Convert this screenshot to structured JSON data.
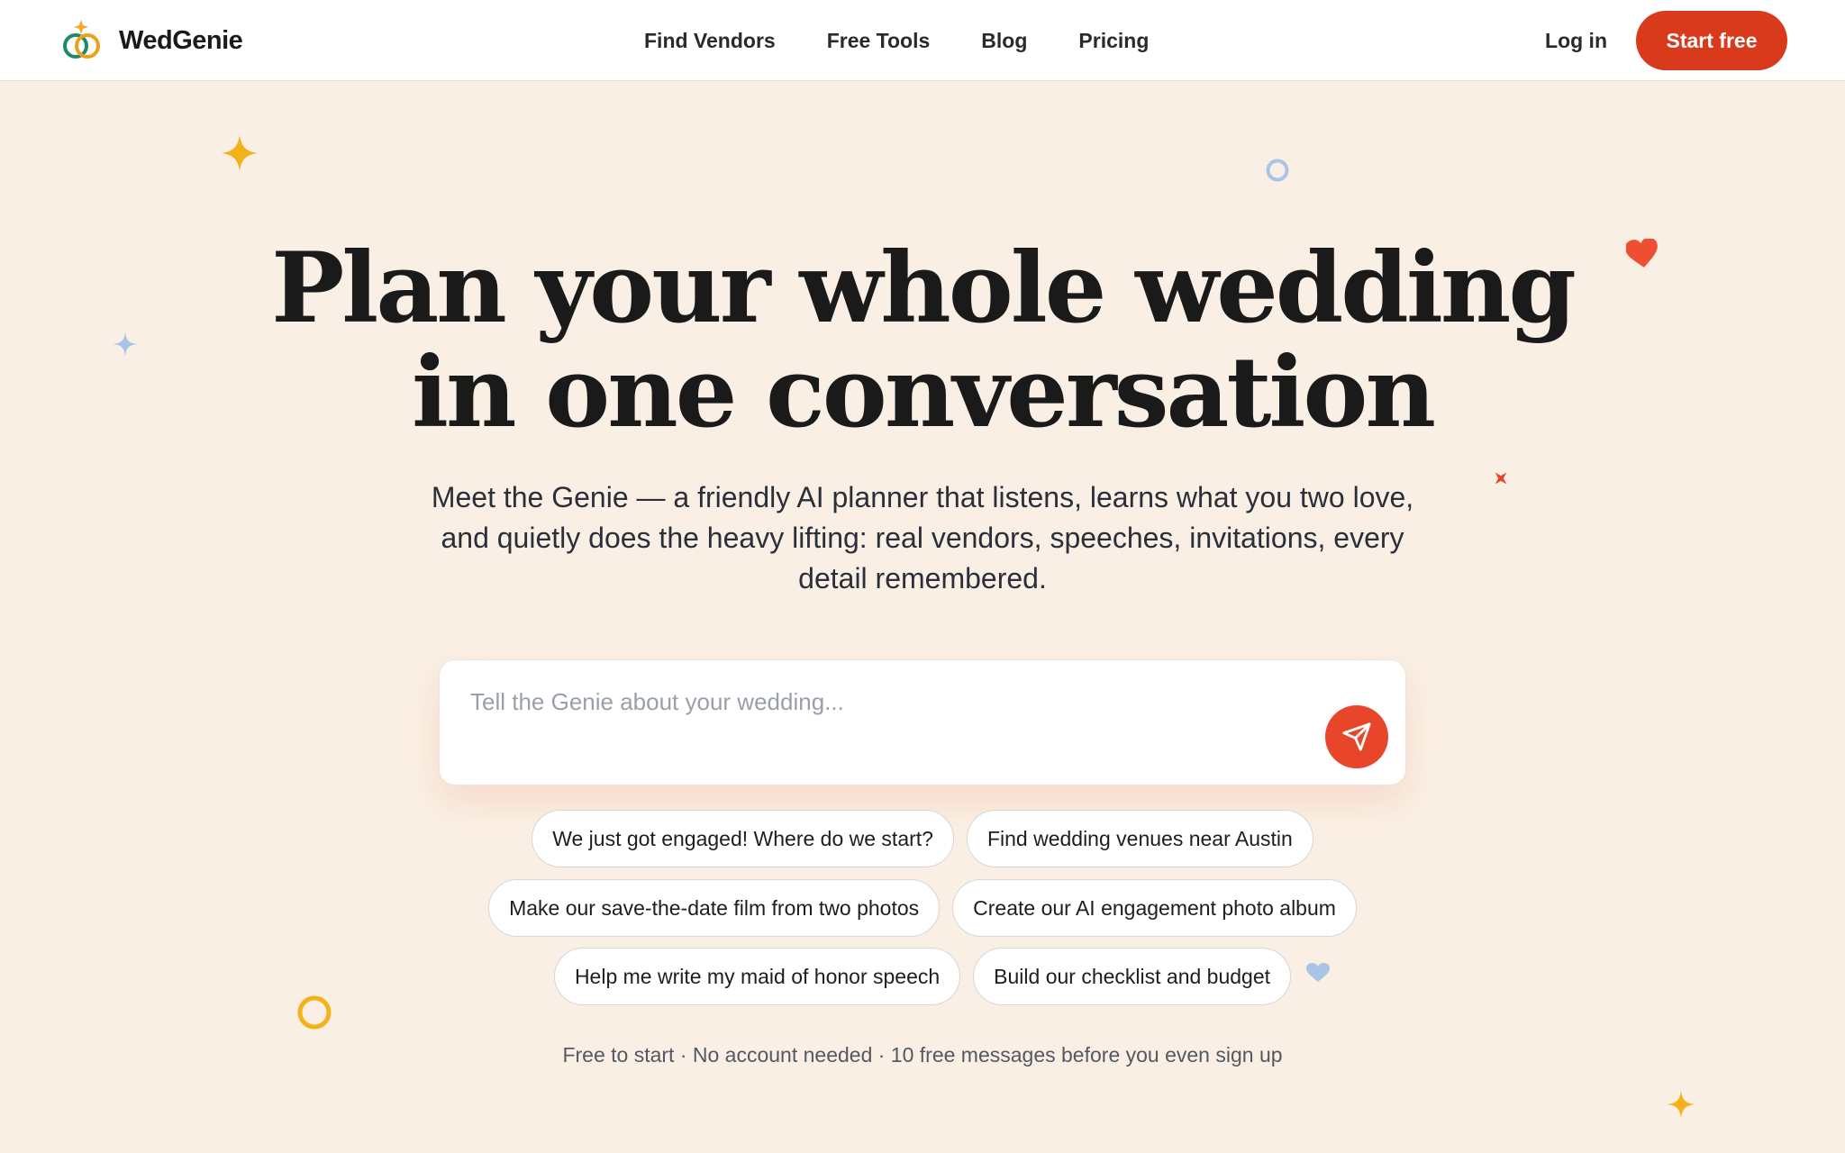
{
  "header": {
    "logo_text": "WedGenie",
    "nav": [
      {
        "label": "Find Vendors"
      },
      {
        "label": "Free Tools"
      },
      {
        "label": "Blog"
      },
      {
        "label": "Pricing"
      }
    ],
    "login_label": "Log in",
    "start_label": "Start free"
  },
  "hero": {
    "headline_line1": "Plan your whole wedding",
    "headline_line2": "in one conversation",
    "subtitle": "Meet the Genie — a friendly AI planner that listens, learns what you two love, and quietly does the heavy lifting: real vendors, speeches, invitations, every detail remembered."
  },
  "chat": {
    "placeholder": "Tell the Genie about your wedding...",
    "value": ""
  },
  "suggestions": [
    "We just got engaged! Where do we start?",
    "Find wedding venues near Austin",
    "Make our save-the-date film from two photos",
    "Create our AI engagement photo album",
    "Help me write my maid of honor speech",
    "Build our checklist and budget"
  ],
  "footnote": "Free to start · No account needed · 10 free messages before you even sign up",
  "colors": {
    "background": "#faefe4",
    "accent": "#d93a1b",
    "send": "#e8462a",
    "star_yellow": "#f4b21a",
    "star_blue": "#a9c4e6",
    "heart_red": "#ef4e33"
  },
  "icons": {
    "logo": "interlocking-rings-icon",
    "send": "paper-plane-icon"
  }
}
